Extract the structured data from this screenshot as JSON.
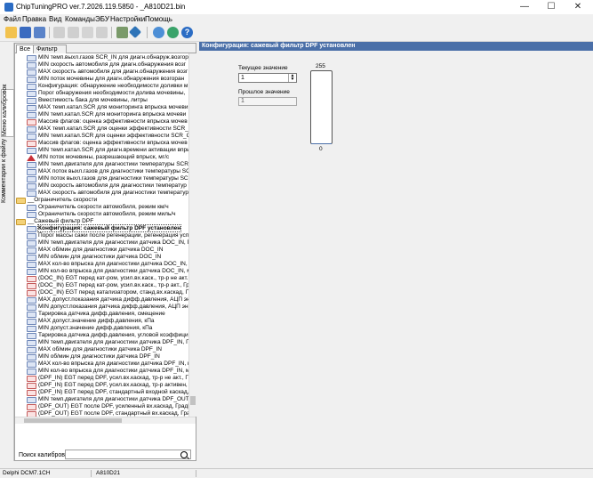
{
  "window": {
    "title": "ChipTuningPRO ver.7.2026.119.5850 - _A810D21.bin",
    "minimize": "—",
    "maximize": "☐",
    "close": "✕"
  },
  "menu": [
    "Файл",
    "Правка",
    "Вид",
    "Команды",
    "ЭБУ",
    "Настройки",
    "Помощь"
  ],
  "toolbar_icons": [
    "open-folder-icon",
    "save-icon",
    "save-as-icon",
    "undo-icon",
    "copy-icon",
    "paste-icon",
    "compare-icon",
    "chip-icon",
    "diamond-icon",
    "search-icon",
    "refresh-icon",
    "help-icon"
  ],
  "side_tabs": {
    "calibrations": "Меню калибровок",
    "comments": "Комментарии к файлу"
  },
  "tree_tabs": {
    "all": "Все",
    "filter": "Фильтр"
  },
  "tree": [
    {
      "icon": "num",
      "text": "MIN темп.выхл.газов SCR_IN для диагн.обнаруж.возгора"
    },
    {
      "icon": "num",
      "text": "MIN скорость автомобиля для диагн.обнаружения возг"
    },
    {
      "icon": "num",
      "text": "MAX скорость автомобиля для диагн.обнаружения возг"
    },
    {
      "icon": "num",
      "text": "MIN поток мочевины для диагн.обнаружения возгоран"
    },
    {
      "icon": "num",
      "text": "Конфигурация: обнаружение необходимости доливки м"
    },
    {
      "icon": "num",
      "text": "Порог обнаружения необходимости долива мочевины,"
    },
    {
      "icon": "num",
      "text": "Вместимость бака для мочевины, литры"
    },
    {
      "icon": "num",
      "text": "MAX темп.катал.SCR для мониторинга впрыска мочеви"
    },
    {
      "icon": "num",
      "text": "MIN темп.катал.SCR для мониторинга впрыска мочеви"
    },
    {
      "icon": "chart",
      "text": "Массив флагов: оценка эффективности впрыска мочев"
    },
    {
      "icon": "num",
      "text": "MAX темп.катал.SCR для оценки эффективности SCR_O"
    },
    {
      "icon": "num",
      "text": "MIN темп.катал.SCR для оценки эффективности SCR_O"
    },
    {
      "icon": "chart",
      "text": "Массив флагов: оценка эффективности впрыска мочев"
    },
    {
      "icon": "num",
      "text": "MIN темп.катал.SCR для диагн.времени активации впры"
    },
    {
      "icon": "tri",
      "text": "MIN поток мочевины, разрешающий впрыск, мг/с"
    },
    {
      "icon": "num",
      "text": "MIN темп.двигателя для диагностики температуры SCR_"
    },
    {
      "icon": "num",
      "text": "MAX поток выхл.газов для диагностики температуры SC"
    },
    {
      "icon": "num",
      "text": "MIN поток выхл.газов для диагностики температуры SCR"
    },
    {
      "icon": "num",
      "text": "MIN скорость автомобиля для диагностики температур"
    },
    {
      "icon": "num",
      "text": "MAX скорость автомобиля для диагностики температур"
    },
    {
      "icon": "folder",
      "text": "__Ограничитель скорости"
    },
    {
      "icon": "num",
      "text": "Ограничитель скорости автомобиля, режим км/ч"
    },
    {
      "icon": "num",
      "text": "Ограничитель скорости автомобиля, режим миль/ч"
    },
    {
      "icon": "folder",
      "text": "__Сажевый фильтр DPF"
    },
    {
      "icon": "num",
      "text": "Конфигурация: сажевый фильтр DPF установлен",
      "selected": true
    },
    {
      "icon": "num",
      "text": "Порог массы сажи после регенерации, регенерация усп"
    },
    {
      "icon": "num",
      "text": "MIN темп.двигателя для диагностики датчика DOC_IN, Гр"
    },
    {
      "icon": "num",
      "text": "MAX об/мин для диагностики датчика DOC_IN"
    },
    {
      "icon": "num",
      "text": "MIN об/мин для диагностики датчика DOC_IN"
    },
    {
      "icon": "num",
      "text": "MAX кол-во впрыска для диагностики датчика DOC_IN, м"
    },
    {
      "icon": "num",
      "text": "MIN кол-во впрыска для диагностики датчика DOC_IN, м"
    },
    {
      "icon": "chart",
      "text": "(DOC_IN) EGT перед кат-ром, усил.вх.каск., тр-р не акт."
    },
    {
      "icon": "chart",
      "text": "(DOC_IN) EGT перед кат-ром, усил.вх.каск., тр-р акт., Гр"
    },
    {
      "icon": "chart",
      "text": "(DOC_IN) EGT перед катализатором, станд.вх.каскад, Гр"
    },
    {
      "icon": "num",
      "text": "MAX допуст.показания датчика дифф.давления, АЦП эн"
    },
    {
      "icon": "num",
      "text": "MIN допуст.показания датчика дифф.давления, АЦП эн"
    },
    {
      "icon": "num",
      "text": "Тарировка датчика дифф.давления, смещение"
    },
    {
      "icon": "num",
      "text": "MAX допуст.значение дифф.давления, кПа"
    },
    {
      "icon": "num",
      "text": "MIN допуст.значение дифф.давления, кПа"
    },
    {
      "icon": "num",
      "text": "Тарировка датчика дифф.давления, угловой коэффици"
    },
    {
      "icon": "num",
      "text": "MIN темп.двигателя для диагностики датчика DPF_IN, Гр"
    },
    {
      "icon": "num",
      "text": "MAX об/мин для диагностики датчика DPF_IN"
    },
    {
      "icon": "num",
      "text": "MIN об/мин для диагностики датчика DPF_IN"
    },
    {
      "icon": "num",
      "text": "MAX кол-во впрыска для диагностики датчика DPF_IN, н"
    },
    {
      "icon": "num",
      "text": "MIN кол-во впрыска для диагностики датчика DPF_IN, м"
    },
    {
      "icon": "chart",
      "text": "(DPF_IN) EGT перед DPF, усил.вх.каскад, тр-р не акт., Г"
    },
    {
      "icon": "chart",
      "text": "(DPF_IN) EGT перед DPF, усил.вх.каскад, тр-р активен,"
    },
    {
      "icon": "chart",
      "text": "(DPF_IN) EGT перед DPF, стандартный входной каскад,"
    },
    {
      "icon": "num",
      "text": "MIN темп.двигателя для диагностики датчика DPF_OUT"
    },
    {
      "icon": "chart",
      "text": "(DPF_OUT) EGT после DPF, усиленный вх.каскад, ГрадЦ"
    },
    {
      "icon": "chart",
      "text": "(DPF_OUT) EGT после DPF, стандартный вх.каскад, Град"
    }
  ],
  "search": {
    "label": "Поиск калибровки",
    "value": ""
  },
  "panel": {
    "header": "Конфигурация: сажевый фильтр DPF установлен",
    "current_label": "Текущее значение",
    "current_value": "1",
    "previous_label": "Прошлое значение",
    "previous_value": "1",
    "gauge_max": "255",
    "gauge_min": "0",
    "gauge_fill": 0.004
  },
  "status": {
    "ecu": "Delphi DCM7.1CH",
    "file": "A810D21"
  },
  "colors": {
    "panel_header": "#4a6fa8",
    "accent": "#2b6cc4"
  }
}
